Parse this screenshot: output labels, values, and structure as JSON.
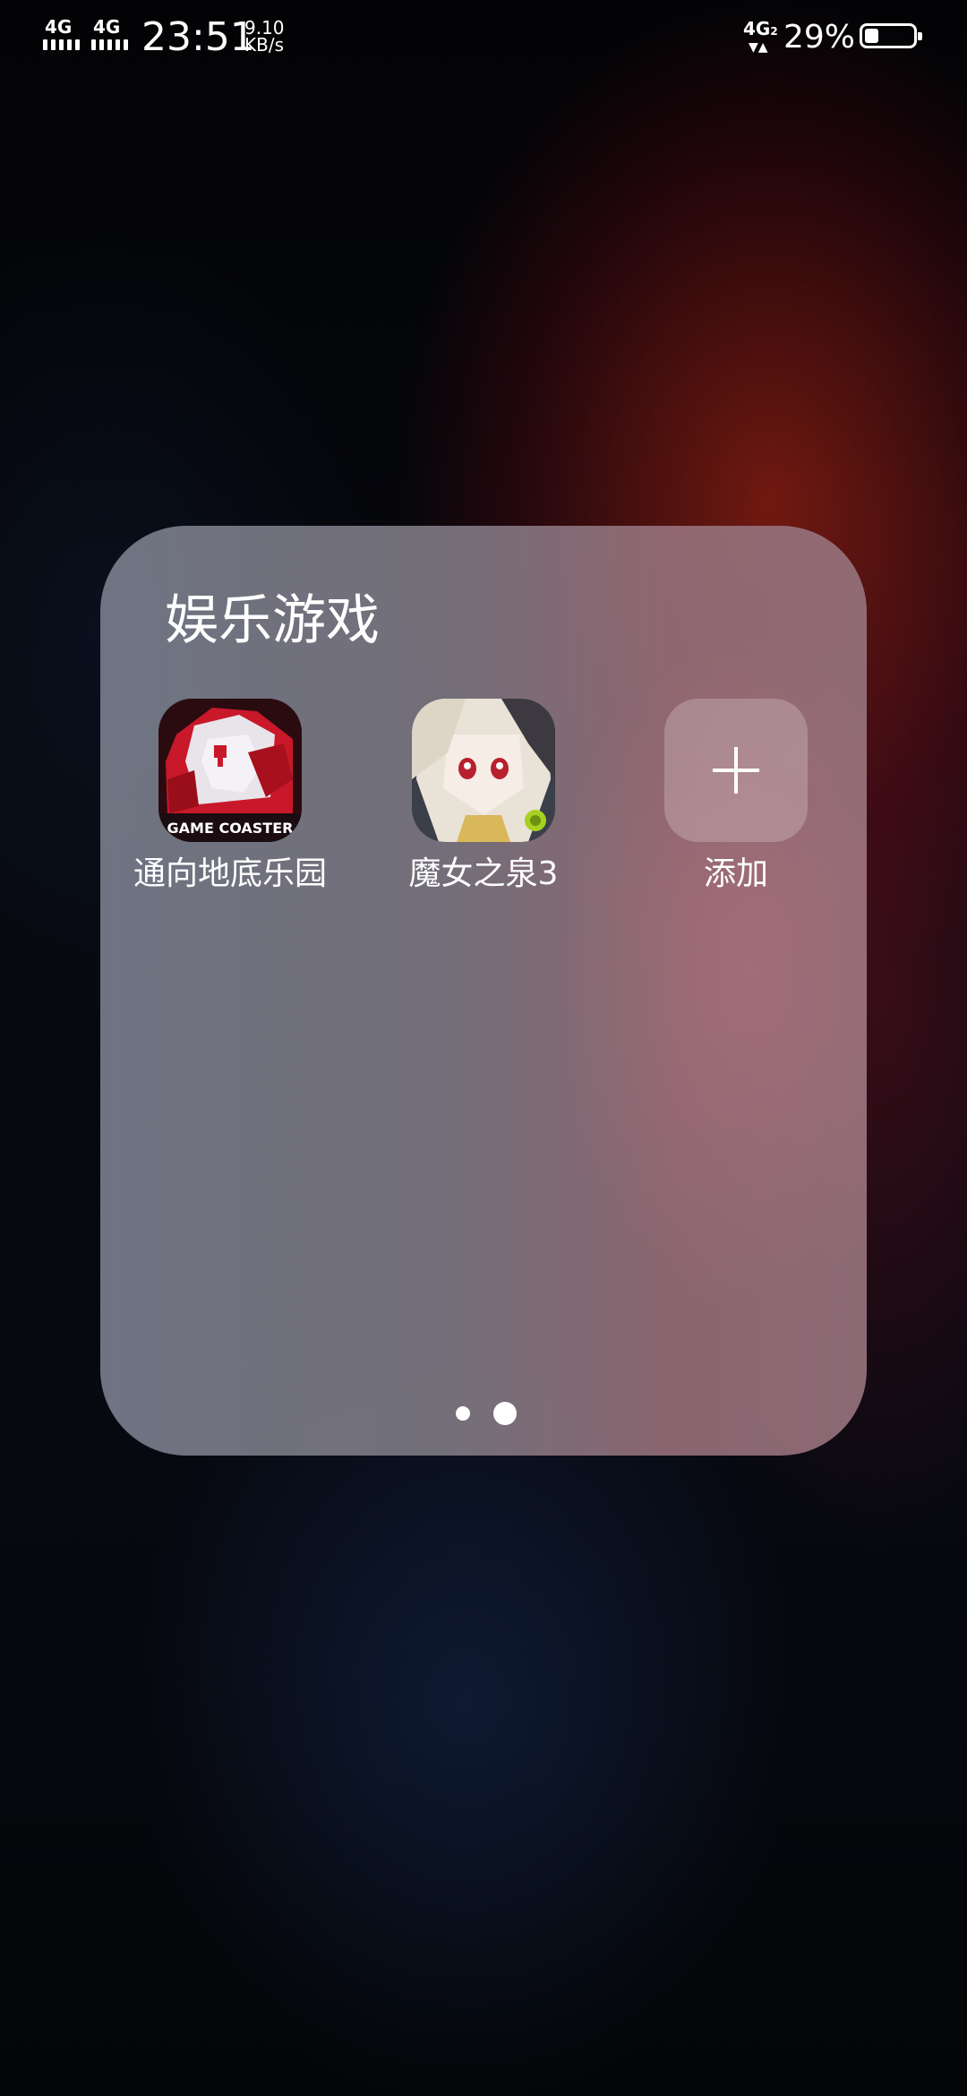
{
  "status_bar": {
    "sim1_network": "4G",
    "sim2_network": "4G",
    "time": "23:51",
    "net_speed_value": "9.10",
    "net_speed_unit": "KB/s",
    "data_network": "4G",
    "data_sim": "2",
    "battery_percent": "29%",
    "battery_level": 0.29
  },
  "folder": {
    "title": "娱乐游戏",
    "apps": [
      {
        "label": "通向地底乐园",
        "icon": "game-coaster-app-icon",
        "icon_text": "GAME COASTER"
      },
      {
        "label": "魔女之泉3",
        "icon": "witch-spring-3-app-icon"
      },
      {
        "label": "添加",
        "icon": "add-icon"
      }
    ],
    "page_indicator": {
      "pages": 2,
      "current": 2
    }
  }
}
